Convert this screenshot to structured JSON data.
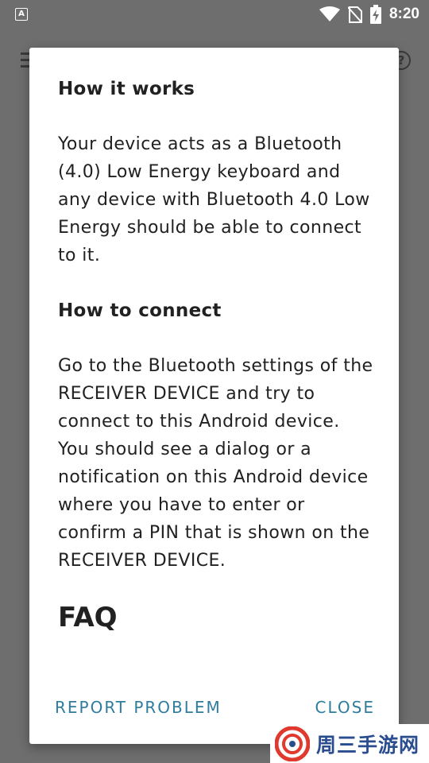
{
  "status_bar": {
    "left_icon": "A",
    "icons": [
      "wifi-icon",
      "no-sim-icon",
      "battery-charging-icon"
    ],
    "time": "8:20"
  },
  "background": {
    "icons": [
      "menu-icon",
      "help-icon"
    ]
  },
  "dialog": {
    "sections": [
      {
        "heading": "How it works",
        "body": "Your device acts as a Bluetooth (4.0) Low Energy keyboard and any device with Bluetooth 4.0 Low Energy should be able to connect to it."
      },
      {
        "heading": "How to connect",
        "body": "Go to the Bluetooth settings of the RECEIVER DEVICE and try to connect to this Android device. You should see a dialog or a notification on this Android device where you have to enter or confirm a PIN that is shown on the RECEIVER DEVICE."
      }
    ],
    "faq_heading": "FAQ",
    "actions": {
      "report_label": "REPORT PROBLEM",
      "close_label": "CLOSE"
    },
    "accent_color": "#2e7d9e"
  },
  "watermark": {
    "text": "周三手游网"
  }
}
